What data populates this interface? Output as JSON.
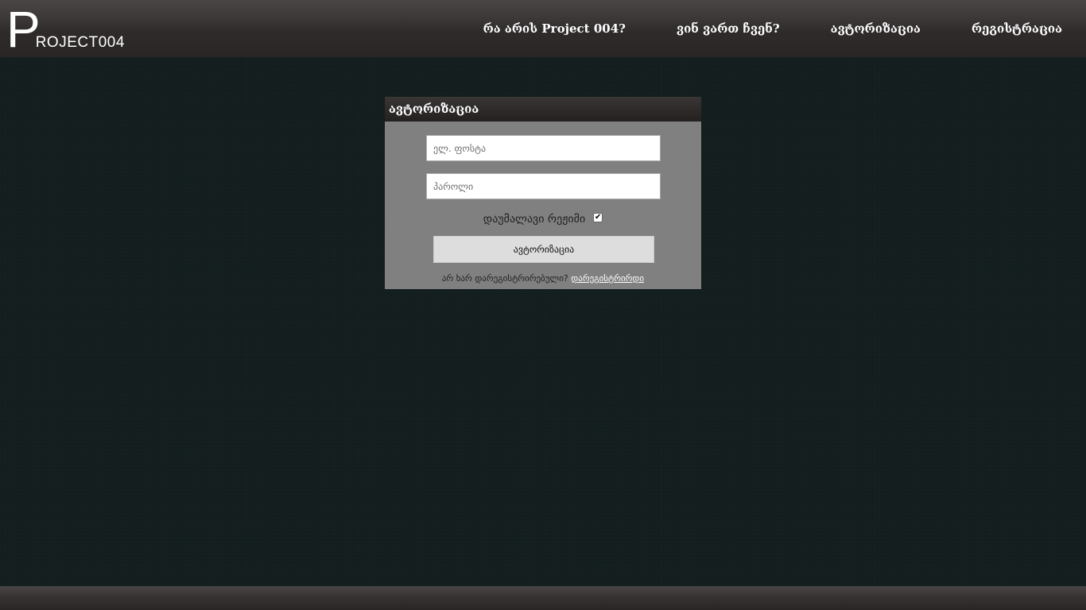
{
  "header": {
    "logo_letter": "P",
    "logo_rest": "ROJECT004",
    "nav": [
      {
        "label": "რა არის Project 004?"
      },
      {
        "label": "ვინ ვართ ჩვენ?"
      },
      {
        "label": "ავტორიზაცია"
      },
      {
        "label": "რეგისტრაცია"
      }
    ]
  },
  "login": {
    "title": "ავტორიზაცია",
    "email_placeholder": "ელ. ფოსტა",
    "password_placeholder": "პაროლი",
    "remember_label": "დაუმალავი რეჟიმი",
    "remember_checked": true,
    "checkmark": "✔",
    "submit_label": "ავტორიზაცია",
    "signup_prompt": "არ ხარ დარეგისტრირებული?",
    "signup_link": "დარეგისტრირდი"
  },
  "colors": {
    "background": "#131e1e",
    "panel": "#808080",
    "header": "#2f2b2b"
  }
}
